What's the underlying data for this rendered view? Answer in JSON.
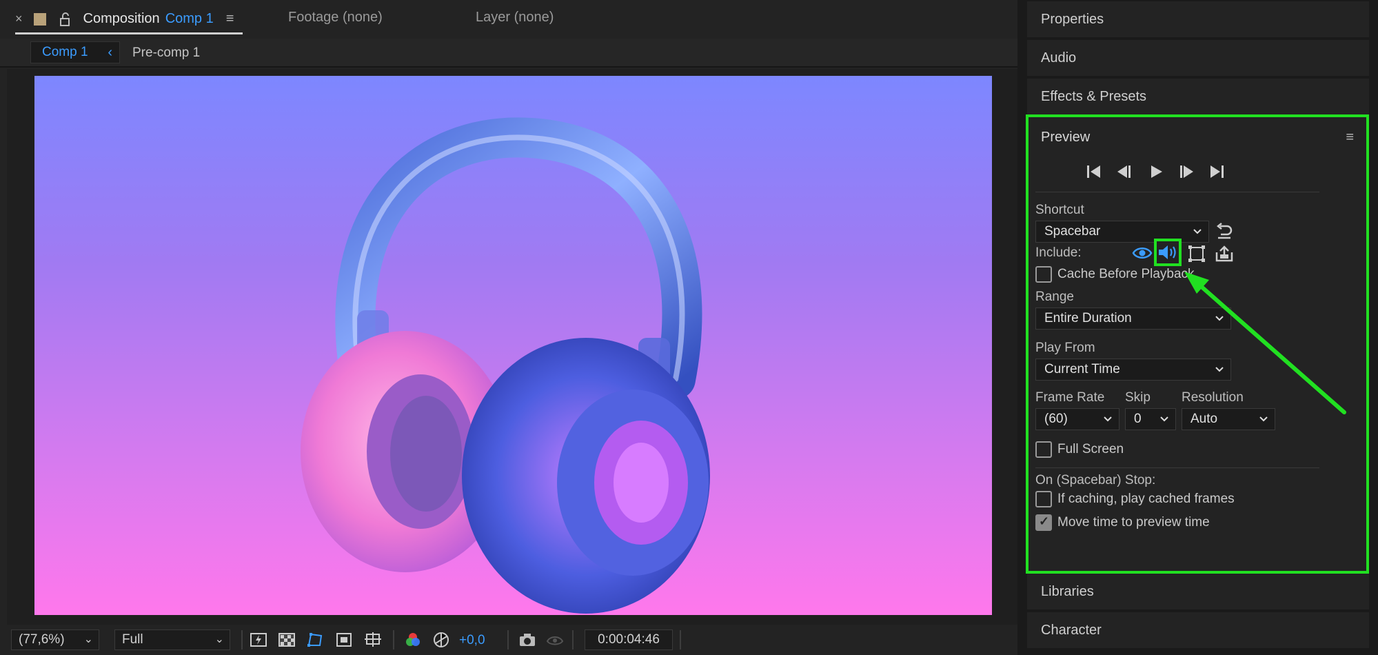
{
  "comp_panel": {
    "close_glyph": "×",
    "tab_title": "Composition",
    "tab_comp_name": "Comp 1",
    "menu_glyph": "≡",
    "footage_tab": "Footage (none)",
    "layer_tab": "Layer (none)",
    "breadcrumb_active": "Comp 1",
    "breadcrumb_chev": "‹",
    "breadcrumb_next": "Pre-comp 1"
  },
  "viewer": {
    "gradient_top": "#7d87ff",
    "gradient_bottom": "#ff78ec",
    "subject": "headphones-image"
  },
  "bottom_bar": {
    "zoom": "(77,6%)",
    "resolution": "Full",
    "exposure": "+0,0",
    "timecode": "0:00:04:46",
    "dropdown_glyph": "⌄"
  },
  "right_panels": {
    "properties": "Properties",
    "audio": "Audio",
    "effects": "Effects & Presets",
    "libraries": "Libraries",
    "character": "Character"
  },
  "preview": {
    "title": "Preview",
    "menu_glyph": "≡",
    "shortcut_label": "Shortcut",
    "shortcut_value": "Spacebar",
    "include_label": "Include:",
    "cache_before_playback": "Cache Before Playback",
    "range_label": "Range",
    "range_value": "Entire Duration",
    "play_from_label": "Play From",
    "play_from_value": "Current Time",
    "frame_rate_label": "Frame Rate",
    "frame_rate_value": "(60)",
    "skip_label": "Skip",
    "skip_value": "0",
    "resolution_label": "Resolution",
    "resolution_value": "Auto",
    "full_screen": "Full Screen",
    "on_stop_label": "On (Spacebar) Stop:",
    "if_caching": "If caching, play cached frames",
    "move_time": "Move time to preview time",
    "checks": {
      "cache": false,
      "full_screen": false,
      "if_caching": false,
      "move_time": true
    },
    "highlight_color": "#21e021",
    "accent_color": "#3b9cff"
  }
}
